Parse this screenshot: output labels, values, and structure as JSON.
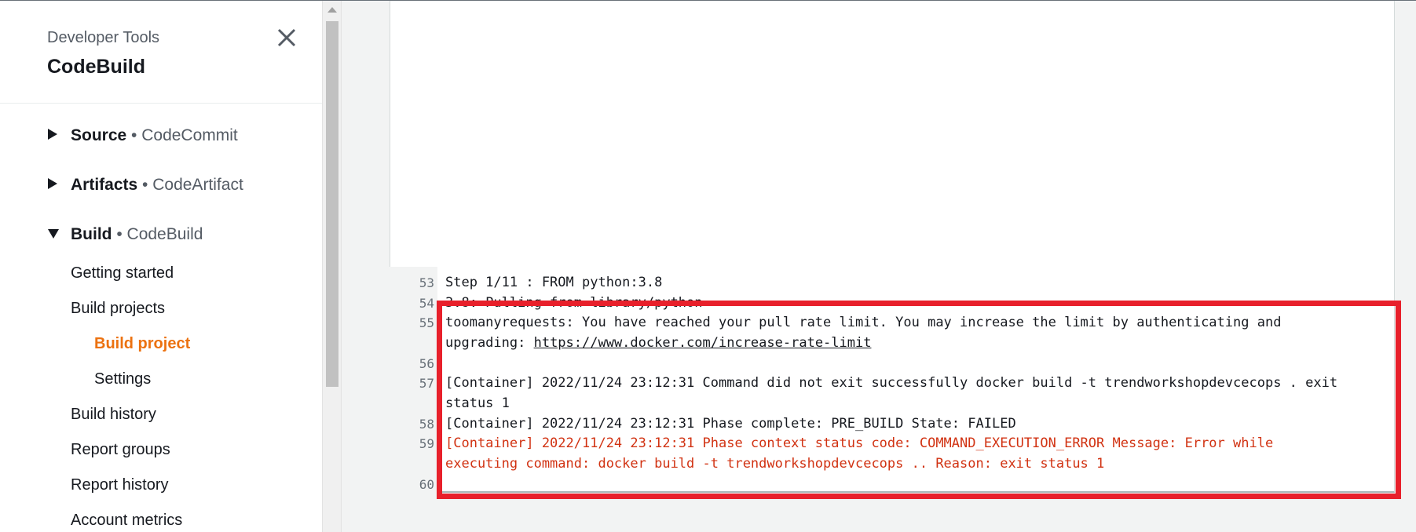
{
  "sidebar": {
    "service_label": "Developer Tools",
    "service_title": "CodeBuild",
    "sections": [
      {
        "title": "Source",
        "sub": "• CodeCommit",
        "expanded": false
      },
      {
        "title": "Artifacts",
        "sub": "• CodeArtifact",
        "expanded": false
      },
      {
        "title": "Build",
        "sub": "• CodeBuild",
        "expanded": true
      }
    ],
    "build_items": {
      "getting_started": "Getting started",
      "build_projects": "Build projects",
      "build_project": "Build project",
      "settings": "Settings",
      "build_history": "Build history",
      "report_groups": "Report groups",
      "report_history": "Report history",
      "account_metrics": "Account metrics"
    }
  },
  "log": {
    "lines": [
      {
        "n": "53",
        "text": "Step 1/11 : FROM python:3.8"
      },
      {
        "n": "54",
        "text": "3.8: Pulling from library/python"
      },
      {
        "n": "55",
        "text_1": "toomanyrequests: You have reached your pull rate limit. You may increase the limit by authenticating and",
        "text_2": "upgrading: ",
        "link": "https://www.docker.com/increase-rate-limit"
      },
      {
        "n": "56",
        "text": ""
      },
      {
        "n": "57",
        "text_1": "[Container] 2022/11/24 23:12:31 Command did not exit successfully docker build -t trendworkshopdevcecops . exit",
        "text_2": "status 1"
      },
      {
        "n": "58",
        "text": "[Container] 2022/11/24 23:12:31 Phase complete: PRE_BUILD State: FAILED"
      },
      {
        "n": "59",
        "text_1": "[Container] 2022/11/24 23:12:31 Phase context status code: COMMAND_EXECUTION_ERROR Message: Error while",
        "text_2": "executing command: docker build -t trendworkshopdevcecops .. Reason: exit status 1"
      },
      {
        "n": "60",
        "text": ""
      }
    ]
  },
  "colors": {
    "accent_orange": "#ec7211",
    "error_red": "#d13212",
    "highlight_red": "#e8202b"
  }
}
